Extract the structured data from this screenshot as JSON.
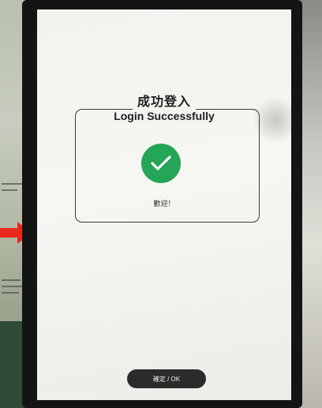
{
  "dialog": {
    "title_zh": "成功登入",
    "title_en": "Login Successfully",
    "welcome_text": "歡迎！",
    "icon": "check-icon",
    "icon_color": "#25a557"
  },
  "footer": {
    "ok_label": "確定 / OK"
  },
  "colors": {
    "arrow": "#e8281b",
    "button_bg": "#2b2b2b"
  }
}
